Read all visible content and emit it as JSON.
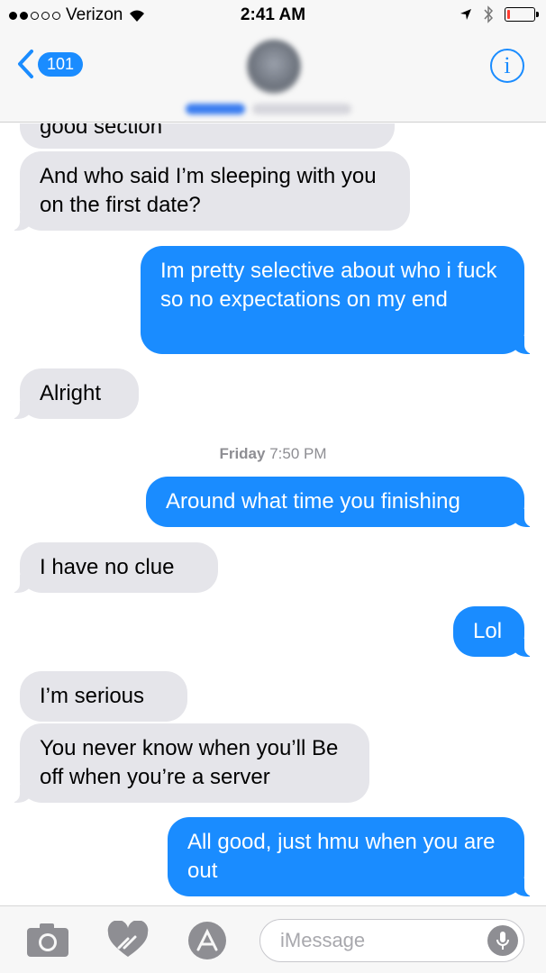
{
  "status_bar": {
    "carrier": "Verizon",
    "time": "2:41 AM",
    "signal_bars": 2,
    "signal_total": 5,
    "battery_level": 0.12,
    "battery_color": "#ff3b30"
  },
  "header": {
    "back_count": "101",
    "info_symbol": "i",
    "accent": "#1a8cff"
  },
  "conversation": {
    "messages": [
      {
        "direction": "incoming",
        "text": "good section"
      },
      {
        "direction": "incoming",
        "text": "And who said I’m sleeping with you on the first date?"
      },
      {
        "direction": "outgoing",
        "text": "Im pretty selective about who i fuck so no expectations on my end"
      },
      {
        "direction": "incoming",
        "text": "Alright"
      },
      {
        "direction": "outgoing",
        "text": "Around what time you finishing"
      },
      {
        "direction": "incoming",
        "text": "I have no clue"
      },
      {
        "direction": "outgoing",
        "text": "Lol"
      },
      {
        "direction": "incoming",
        "text": "I’m serious"
      },
      {
        "direction": "incoming",
        "text": "You never know when you’ll Be off when you’re a server"
      },
      {
        "direction": "outgoing",
        "text": "All good, just hmu when you are out"
      }
    ],
    "timestamp": {
      "day": "Friday",
      "time": "7:50 PM"
    },
    "colors": {
      "incoming": "#e5e5ea",
      "outgoing": "#1a8cff"
    }
  },
  "input_bar": {
    "placeholder": "iMessage",
    "icons": [
      "camera-icon",
      "digital-touch-icon",
      "app-store-icon",
      "microphone-icon"
    ]
  }
}
